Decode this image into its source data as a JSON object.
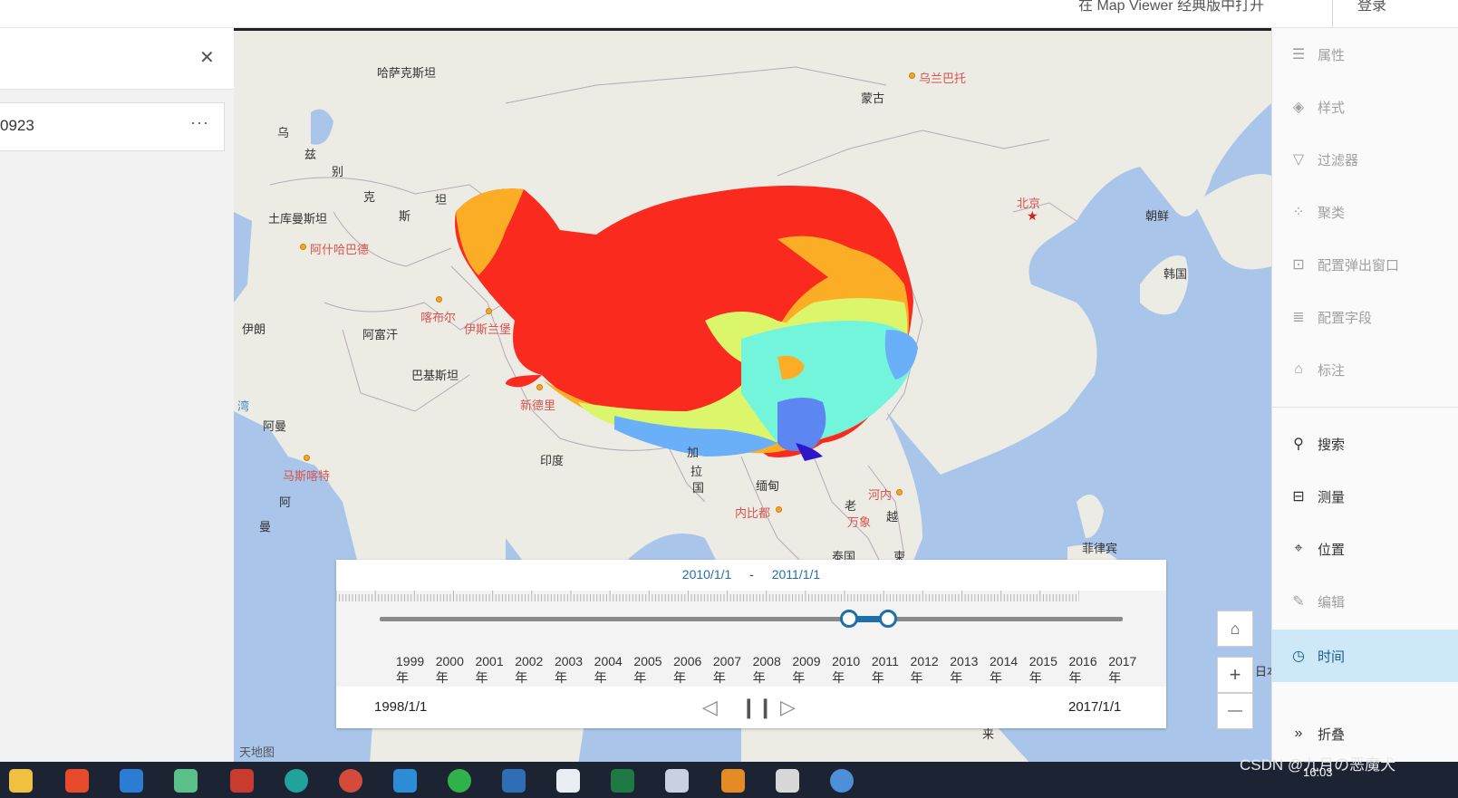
{
  "header": {
    "top_link": "在 Map Viewer 经典版中打开",
    "login": "登录"
  },
  "left_panel": {
    "close_icon": "close-icon",
    "layer_name": "0923",
    "more_label": "···"
  },
  "map": {
    "attribution": "天地图",
    "labels": {
      "kazakhstan": "哈萨克斯坦",
      "mongolia": "蒙古",
      "ulaanbaatar": "乌兰巴托",
      "uzbek_1": "乌",
      "uzbek_2": "兹",
      "uzbek_3": "别",
      "uzbek_4": "克",
      "uzbek_5": "斯",
      "uzbek_6": "坦",
      "turkmenistan": "土库曼斯坦",
      "ashgabat": "阿什哈巴德",
      "beijing": "北京",
      "korea_n": "朝鲜",
      "korea_s": "韩国",
      "kabul": "喀布尔",
      "islamabad": "伊斯兰堡",
      "iran": "伊朗",
      "afghanistan": "阿富汗",
      "pakistan": "巴基斯坦",
      "gulf": "湾",
      "oman": "阿曼",
      "muscat": "马斯喀特",
      "newdelhi": "新德里",
      "india": "印度",
      "oman2_1": "阿",
      "oman2_2": "曼",
      "bangla_1": "加",
      "bangla_2": "拉",
      "bangla_3": "国",
      "myanmar": "缅甸",
      "naypyidaw": "内比都",
      "laos": "老",
      "vientiane": "万象",
      "hanoi": "河内",
      "vietnam": "越",
      "thailand": "泰国",
      "cambodia": "柬",
      "philippines": "菲律宾",
      "malay": "来",
      "japan_cut": "日本"
    }
  },
  "time_slider": {
    "range_start": "2010/1/1",
    "range_sep": "-",
    "range_end": "2011/1/1",
    "years": [
      "1999年",
      "2000年",
      "2001年",
      "2002年",
      "2003年",
      "2004年",
      "2005年",
      "2006年",
      "2007年",
      "2008年",
      "2009年",
      "2010年",
      "2011年",
      "2012年",
      "2013年",
      "2014年",
      "2015年",
      "2016年",
      "2017年"
    ],
    "start_label": "1998/1/1",
    "end_label": "2017/1/1",
    "selection_start_fraction": 0.632,
    "selection_end_fraction": 0.684
  },
  "map_buttons": {
    "home_icon": "home-icon",
    "zoom_in": "+",
    "zoom_out": "—"
  },
  "right_toolbar": {
    "items": [
      {
        "label": "属性",
        "icon": "sliders-icon"
      },
      {
        "label": "样式",
        "icon": "style-icon"
      },
      {
        "label": "过滤器",
        "icon": "filter-icon"
      },
      {
        "label": "聚类",
        "icon": "cluster-icon"
      },
      {
        "label": "配置弹出窗口",
        "icon": "popup-icon"
      },
      {
        "label": "配置字段",
        "icon": "fields-icon"
      },
      {
        "label": "标注",
        "icon": "label-icon"
      },
      {
        "label": "搜索",
        "icon": "search-icon"
      },
      {
        "label": "测量",
        "icon": "measure-icon"
      },
      {
        "label": "位置",
        "icon": "location-icon"
      },
      {
        "label": "编辑",
        "icon": "edit-icon"
      },
      {
        "label": "时间",
        "icon": "clock-icon"
      },
      {
        "label": "折叠",
        "icon": "collapse-icon"
      }
    ]
  },
  "taskbar": {
    "watermark": "CSDN @九月の恶魔犬",
    "time": "16:03"
  }
}
